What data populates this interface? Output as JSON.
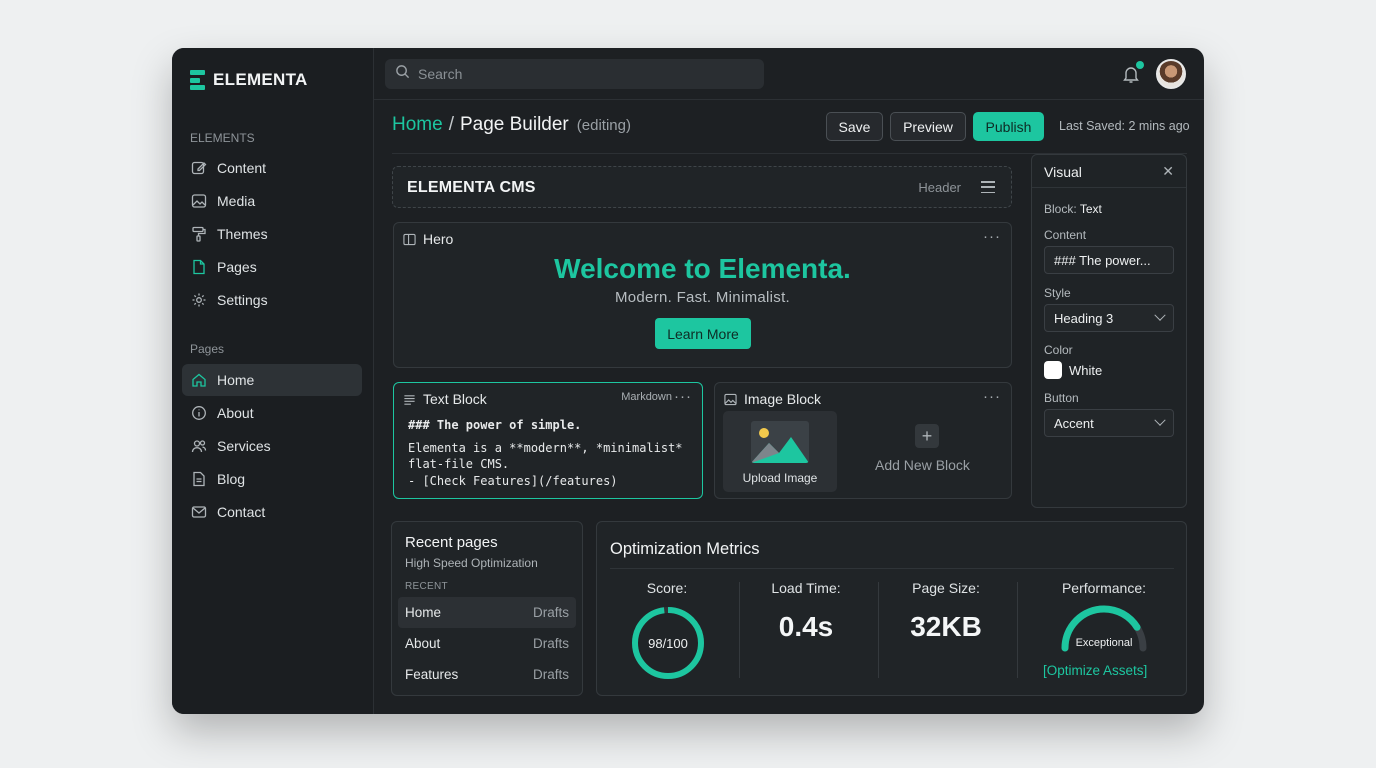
{
  "brand": {
    "name": "ELEMENTA",
    "accent": "#1dc6a0"
  },
  "sidebar": {
    "elements_label": "ELEMENTS",
    "elements": [
      {
        "label": "Content",
        "icon": "edit-icon"
      },
      {
        "label": "Media",
        "icon": "image-icon"
      },
      {
        "label": "Themes",
        "icon": "paint-roller-icon"
      },
      {
        "label": "Pages",
        "icon": "file-icon"
      },
      {
        "label": "Settings",
        "icon": "gear-icon"
      }
    ],
    "pages_label": "Pages",
    "pages": [
      {
        "label": "Home",
        "icon": "home-icon",
        "active": true
      },
      {
        "label": "About",
        "icon": "info-icon"
      },
      {
        "label": "Services",
        "icon": "users-icon"
      },
      {
        "label": "Blog",
        "icon": "document-icon"
      },
      {
        "label": "Contact",
        "icon": "mail-icon"
      }
    ]
  },
  "topbar": {
    "search_placeholder": "Search"
  },
  "breadcrumb": {
    "home": "Home",
    "separator": "/",
    "page": "Page Builder",
    "status": "(editing)"
  },
  "actions": {
    "save": "Save",
    "preview": "Preview",
    "publish": "Publish",
    "last_saved": "Last Saved: 2 mins ago"
  },
  "canvas": {
    "header_block": {
      "title": "ELEMENTA CMS",
      "tag": "Header"
    },
    "hero_block": {
      "label": "Hero",
      "title": "Welcome to Elementa.",
      "subtitle": "Modern. Fast. Minimalist.",
      "button": "Learn More"
    },
    "text_block": {
      "label": "Text Block",
      "tag": "Markdown",
      "line1": "### The power of simple.",
      "line2": "Elementa is a **modern**, *minimalist*",
      "line3": "flat-file CMS.",
      "line4": "- [Check Features](/features)"
    },
    "image_block": {
      "label": "Image Block",
      "upload": "Upload Image",
      "add": "Add New Block"
    }
  },
  "inspector": {
    "title": "Visual",
    "block_label": "Block:",
    "block_value": "Text",
    "content_label": "Content",
    "content_value": "### The power...",
    "style_label": "Style",
    "style_value": "Heading 3",
    "color_label": "Color",
    "color_value": "White",
    "color_hex": "#ffffff",
    "button_label": "Button",
    "button_value": "Accent"
  },
  "recent": {
    "title": "Recent pages",
    "subtitle": "High Speed Optimization",
    "label": "RECENT",
    "rows": [
      {
        "name": "Home",
        "state": "Drafts"
      },
      {
        "name": "About",
        "state": "Drafts"
      },
      {
        "name": "Features",
        "state": "Drafts"
      }
    ]
  },
  "metrics": {
    "title": "Optimization Metrics",
    "score_label": "Score:",
    "score_value": "98/100",
    "score_fraction": 0.98,
    "load_label": "Load Time:",
    "load_value": "0.4s",
    "size_label": "Page Size:",
    "size_value": "32KB",
    "perf_label": "Performance:",
    "perf_value": "Exceptional",
    "perf_fraction": 0.82,
    "optimize_link": "[Optimize Assets]"
  }
}
